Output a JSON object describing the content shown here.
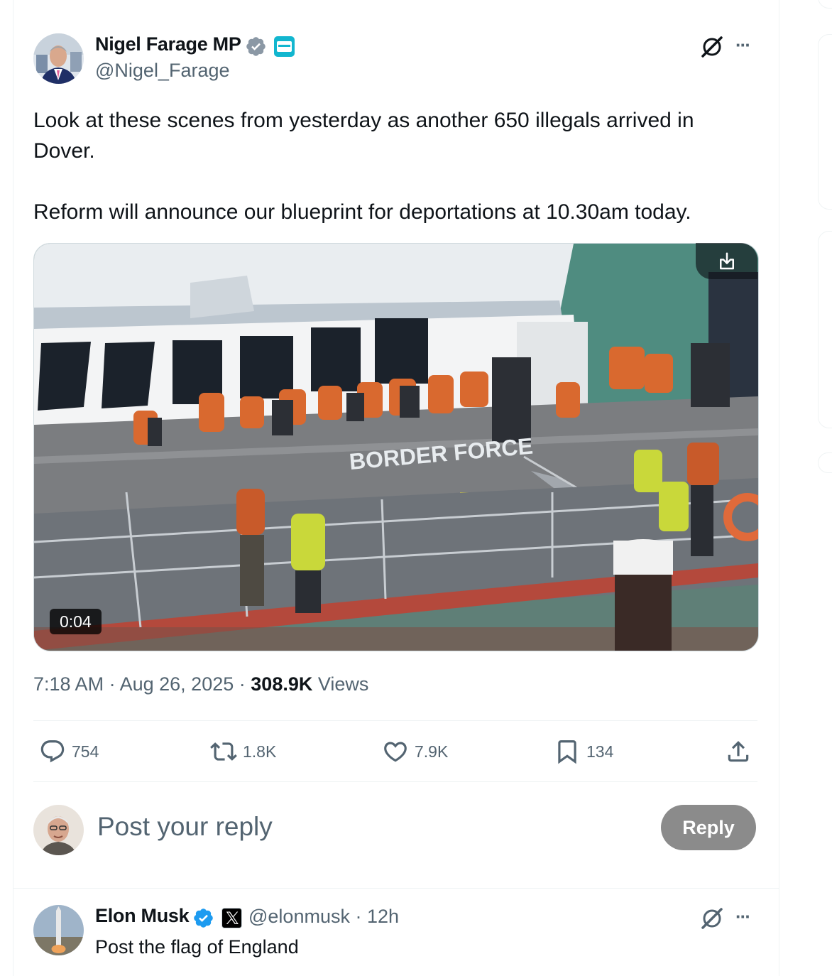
{
  "tweet": {
    "author": {
      "name": "Nigel Farage MP",
      "handle": "@Nigel_Farage",
      "badge_label": "REFORM"
    },
    "text_paragraphs": [
      "Look at these scenes from yesterday as another 650 illegals arrived in Dover.",
      "Reform will announce our blueprint for deportations at 10.30am today."
    ],
    "media": {
      "duration": "0:04",
      "boat_lettering": "BORDER FORCE"
    },
    "time": "7:18 AM",
    "date": "Aug 26, 2025",
    "separator": "·",
    "views_count": "308.9K",
    "views_label": "Views",
    "actions": {
      "replies": "754",
      "reposts": "1.8K",
      "likes": "7.9K",
      "bookmarks": "134"
    }
  },
  "composer": {
    "placeholder": "Post your reply",
    "reply_button": "Reply"
  },
  "reply": {
    "name": "Elon Musk",
    "handle": "@elonmusk",
    "separator": "·",
    "age": "12h",
    "text": "Post the flag of England"
  },
  "colors": {
    "verified_blue": "#1d9bf0",
    "muted_text": "#536471",
    "reply_button_bg": "#8b8b8b",
    "reform_badge": "#12b6cf"
  },
  "icons": [
    "grok-icon",
    "more-icon",
    "download-icon",
    "reply-icon",
    "repost-icon",
    "like-icon",
    "bookmark-icon",
    "share-icon",
    "verified-icon",
    "x-logo-icon"
  ]
}
